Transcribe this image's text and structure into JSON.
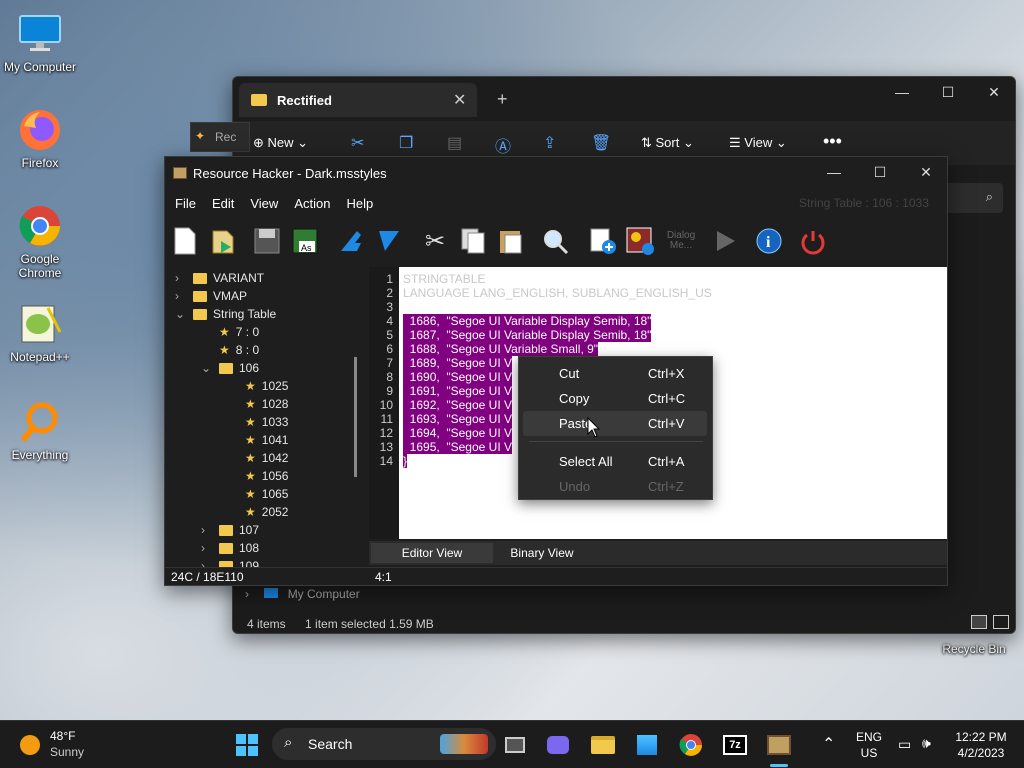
{
  "desktop": {
    "icons": [
      {
        "label": "My Computer"
      },
      {
        "label": "Firefox"
      },
      {
        "label": "Google Chrome"
      },
      {
        "label": "Notepad++"
      },
      {
        "label": "Everything"
      },
      {
        "label": "Recycle Bin"
      }
    ]
  },
  "explorer": {
    "tab_title": "Rectified",
    "toolbar": {
      "new": "New",
      "sort": "Sort",
      "view": "View"
    },
    "status": {
      "items": "4 items",
      "selected": "1 item selected  1.59 MB"
    },
    "tree_item": "My Computer",
    "back_tab": "Rec"
  },
  "reshacker": {
    "title": "Resource Hacker - Dark.msstyles",
    "menu": [
      "File",
      "Edit",
      "View",
      "Action",
      "Help"
    ],
    "toolbar_label": "String Table : 106 : 1033",
    "dialog_label": [
      "Dialog",
      "Me..."
    ],
    "tree": [
      {
        "label": "VARIANT",
        "type": "folder",
        "level": 0,
        "exp": ">"
      },
      {
        "label": "VMAP",
        "type": "folder",
        "level": 0,
        "exp": ">"
      },
      {
        "label": "String Table",
        "type": "folder",
        "level": 0,
        "exp": "v"
      },
      {
        "label": "7 : 0",
        "type": "star",
        "level": 1,
        "exp": ""
      },
      {
        "label": "8 : 0",
        "type": "star",
        "level": 1,
        "exp": ""
      },
      {
        "label": "106",
        "type": "folder",
        "level": 1,
        "exp": "v"
      },
      {
        "label": "1025",
        "type": "star",
        "level": 2,
        "exp": ""
      },
      {
        "label": "1028",
        "type": "star",
        "level": 2,
        "exp": ""
      },
      {
        "label": "1033",
        "type": "star",
        "level": 2,
        "exp": ""
      },
      {
        "label": "1041",
        "type": "star",
        "level": 2,
        "exp": ""
      },
      {
        "label": "1042",
        "type": "star",
        "level": 2,
        "exp": ""
      },
      {
        "label": "1056",
        "type": "star",
        "level": 2,
        "exp": ""
      },
      {
        "label": "1065",
        "type": "star",
        "level": 2,
        "exp": ""
      },
      {
        "label": "2052",
        "type": "star",
        "level": 2,
        "exp": ""
      },
      {
        "label": "107",
        "type": "folder",
        "level": 1,
        "exp": ">"
      },
      {
        "label": "108",
        "type": "folder",
        "level": 1,
        "exp": ">"
      },
      {
        "label": "109",
        "type": "folder",
        "level": 1,
        "exp": ">"
      }
    ],
    "editor": {
      "line_numbers": [
        "1",
        "2",
        "3",
        "4",
        "5",
        "6",
        "7",
        "8",
        "9",
        "10",
        "11",
        "12",
        "13",
        "14"
      ],
      "lines": [
        "STRINGTABLE",
        "LANGUAGE LANG_ENGLISH, SUBLANG_ENGLISH_US",
        "",
        "  1686,  \"Segoe UI Variable Display Semib, 18\"",
        "  1687,  \"Segoe UI Variable Display Semib, 18\"",
        "  1688,  \"Segoe UI Variable Small, 9\"",
        "  1689,  \"Segoe UI V",
        "  1690,  \"Segoe UI V",
        "  1691,  \"Segoe UI V",
        "  1692,  \"Segoe UI V",
        "  1693,  \"Segoe UI V",
        "  1694,  \"Segoe UI V",
        "  1695,  \"Segoe UI V",
        "}"
      ]
    },
    "tabs": {
      "editor": "Editor View",
      "binary": "Binary View"
    },
    "status": {
      "left": "24C / 18E110",
      "right": "4:1"
    }
  },
  "context_menu": {
    "items": [
      {
        "label": "Cut",
        "shortcut": "Ctrl+X"
      },
      {
        "label": "Copy",
        "shortcut": "Ctrl+C"
      },
      {
        "label": "Paste",
        "shortcut": "Ctrl+V"
      },
      {
        "label": "Select All",
        "shortcut": "Ctrl+A"
      },
      {
        "label": "Undo",
        "shortcut": "Ctrl+Z"
      }
    ]
  },
  "taskbar": {
    "weather_temp": "48°F",
    "weather_desc": "Sunny",
    "search": "Search",
    "lang1": "ENG",
    "lang2": "US",
    "time": "12:22 PM",
    "date": "4/2/2023"
  },
  "colors": {
    "selection": "#800080",
    "accent": "#0078d4"
  }
}
